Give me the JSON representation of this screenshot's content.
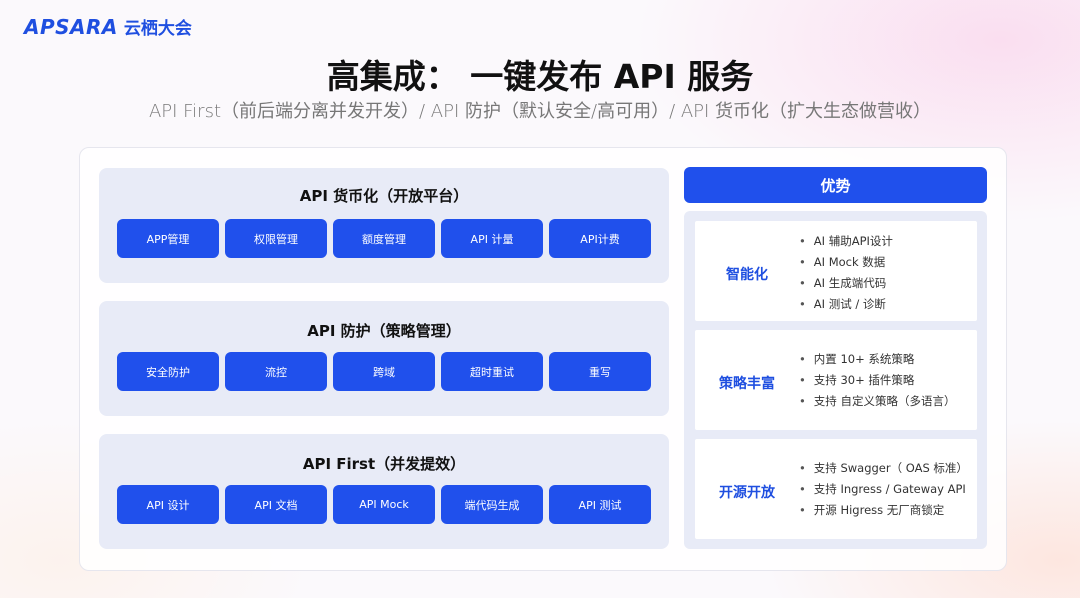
{
  "logo": {
    "brand": "APSARA",
    "name_cn": "云栖大会"
  },
  "title": "高集成： 一键发布 API 服务",
  "subtitle": "API First（前后端分离并发开发）/ API 防护（默认安全/高可用）/ API 货币化（扩大生态做营收）",
  "panels": [
    {
      "title": "API 货币化（开放平台）",
      "buttons": [
        "APP管理",
        "权限管理",
        "额度管理",
        "API 计量",
        "API计费"
      ]
    },
    {
      "title": "API 防护（策略管理）",
      "buttons": [
        "安全防护",
        "流控",
        "跨域",
        "超时重试",
        "重写"
      ]
    },
    {
      "title": "API First（并发提效）",
      "buttons": [
        "API 设计",
        "API 文档",
        "API Mock",
        "端代码生成",
        "API 测试"
      ]
    }
  ],
  "advantages": {
    "header": "优势",
    "cards": [
      {
        "title": "智能化",
        "items": [
          "AI 辅助API设计",
          "AI Mock 数据",
          "AI 生成端代码",
          "AI 测试 / 诊断"
        ]
      },
      {
        "title": "策略丰富",
        "items": [
          "内置 10+ 系统策略",
          "支持 30+ 插件策略",
          "支持 自定义策略（多语言）"
        ]
      },
      {
        "title": "开源开放",
        "items": [
          "支持 Swagger（ OAS 标准）",
          "支持 Ingress / Gateway API",
          "开源 Higress 无厂商锁定"
        ]
      }
    ]
  },
  "colors": {
    "accent": "#2050ec",
    "panel_bg": "#e8ebf7",
    "title_text": "#111111"
  }
}
